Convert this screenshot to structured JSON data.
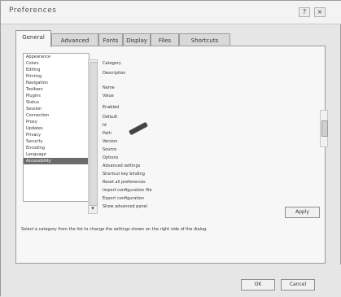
{
  "window": {
    "title": "Preferences",
    "controls": [
      "?",
      "×"
    ]
  },
  "tabs": [
    {
      "label": "General"
    },
    {
      "label": "Advanced"
    },
    {
      "label": "Fonts"
    },
    {
      "label": "Display"
    },
    {
      "label": "Files"
    },
    {
      "label": "Shortcuts"
    }
  ],
  "list": {
    "items": [
      "Appearance",
      "Colors",
      "Editing",
      "Printing",
      "Navigation",
      "Toolbars",
      "Plugins",
      "Status",
      "Session",
      "Connection",
      "Proxy",
      "Updates",
      "Privacy",
      "Security",
      "Encoding",
      "Language",
      "Accessibility"
    ],
    "selected_index": 16
  },
  "details": {
    "lines": [
      "Category",
      "Description",
      "Name",
      "Value",
      "Enabled",
      "Default",
      "Id",
      "Path",
      "Version",
      "Source",
      "Options",
      "Advanced settings",
      "Shortcut key binding",
      "Reset all preferences",
      "Import configuration file",
      "Export configuration",
      "Show advanced panel"
    ]
  },
  "buttons": {
    "apply": "Apply",
    "ok": "OK",
    "cancel": "Cancel"
  },
  "status": {
    "line1": "Select a category from the list to change the settings shown on the right side of the dialog.",
    "line2": ""
  }
}
